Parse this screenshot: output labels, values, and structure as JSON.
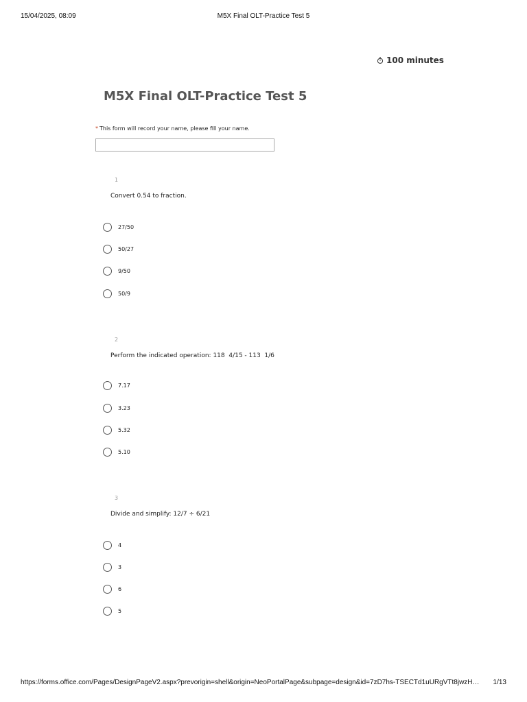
{
  "print_header": {
    "date": "15/04/2025, 08:09",
    "title": "M5X Final OLT-Practice Test 5"
  },
  "print_footer": {
    "url": "https://forms.office.com/Pages/DesignPageV2.aspx?prevorigin=shell&origin=NeoPortalPage&subpage=design&id=7zD7hs-TSECTd1uURgVTt8jwzH…",
    "page": "1/13"
  },
  "timer": {
    "icon": "stopwatch-icon",
    "label": "100 minutes"
  },
  "form": {
    "title": "M5X Final OLT-Practice Test 5",
    "name_prompt": {
      "required_mark": "*",
      "text": "This form will record your name, please fill your name."
    },
    "name_value": ""
  },
  "questions": [
    {
      "number": "1",
      "text": "Convert 0.54 to fraction.",
      "options": [
        "27/50",
        "50/27",
        "9/50",
        "50/9"
      ]
    },
    {
      "number": "2",
      "text": "Perform the indicated operation: 118  4/15 - 113  1/6",
      "options": [
        "7.17",
        "3.23",
        "5.32",
        "5.10"
      ]
    },
    {
      "number": "3",
      "text": "Divide and simplify: 12/7 ÷ 6/21",
      "options": [
        "4",
        "3",
        "6",
        "5"
      ]
    }
  ],
  "colors": {
    "required": "#c43e1c",
    "title": "#555555",
    "question_number": "#9a9a9a"
  }
}
